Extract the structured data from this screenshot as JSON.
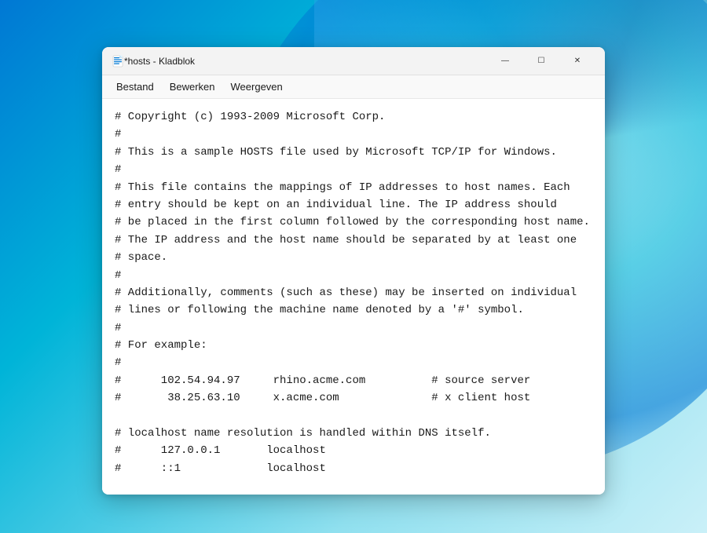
{
  "desktop": {
    "bg_color_start": "#0078d4",
    "bg_color_end": "#48cae4"
  },
  "window": {
    "title": "*hosts - Kladblok",
    "controls": {
      "minimize": "—",
      "maximize": "☐",
      "close": "✕"
    }
  },
  "menubar": {
    "items": [
      "Bestand",
      "Bewerken",
      "Weergeven"
    ]
  },
  "editor": {
    "content_lines": [
      "# Copyright (c) 1993-2009 Microsoft Corp.",
      "#",
      "# This is a sample HOSTS file used by Microsoft TCP/IP for Windows.",
      "#",
      "# This file contains the mappings of IP addresses to host names. Each",
      "# entry should be kept on an individual line. The IP address should",
      "# be placed in the first column followed by the corresponding host name.",
      "# The IP address and the host name should be separated by at least one",
      "# space.",
      "#",
      "# Additionally, comments (such as these) may be inserted on individual",
      "# lines or following the machine name denoted by a '#' symbol.",
      "#",
      "# For example:",
      "#",
      "#      102.54.94.97     rhino.acme.com          # source server",
      "#       38.25.63.10     x.acme.com              # x client host",
      "",
      "# localhost name resolution is handled within DNS itself.",
      "#      127.0.0.1       localhost",
      "#      ::1             localhost",
      ""
    ]
  }
}
